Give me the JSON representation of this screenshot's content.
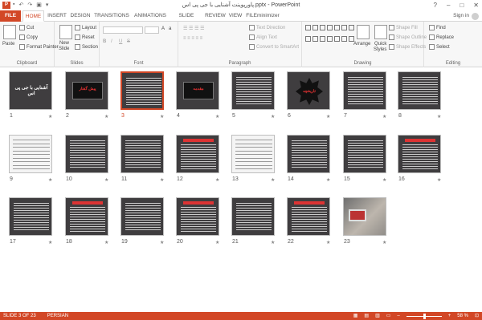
{
  "window": {
    "title": "پاورپوینت آشنایی با جی پی اس.pptx - PowerPoint",
    "app_icon": "P",
    "controls": [
      "?",
      "–",
      "□",
      "✕"
    ]
  },
  "tabs": [
    "FILE",
    "HOME",
    "INSERT",
    "DESIGN",
    "TRANSITIONS",
    "ANIMATIONS",
    "SLIDE SHOW",
    "REVIEW",
    "VIEW",
    "FILEminimizer"
  ],
  "active_tab": "HOME",
  "signin_label": "Sign in",
  "ribbon": {
    "clipboard": {
      "paste": "Paste",
      "cut": "Cut",
      "copy": "Copy",
      "format_painter": "Format Painter",
      "label": "Clipboard"
    },
    "slides": {
      "new_slide_1": "New",
      "new_slide_2": "Slide",
      "layout": "Layout",
      "reset": "Reset",
      "section": "Section",
      "label": "Slides"
    },
    "font": {
      "bold": "B",
      "italic": "I",
      "underline": "U",
      "strike": "S",
      "label": "Font"
    },
    "paragraph": {
      "text_direction": "Text Direction",
      "align_text": "Align Text",
      "convert": "Convert to SmartArt",
      "label": "Paragraph"
    },
    "drawing": {
      "arrange": "Arrange",
      "quick_styles_1": "Quick",
      "quick_styles_2": "Styles",
      "shape_fill": "Shape Fill",
      "shape_outline": "Shape Outline",
      "shape_effects": "Shape Effects",
      "label": "Drawing"
    },
    "editing": {
      "find": "Find",
      "replace": "Replace",
      "select": "Select",
      "label": "Editing"
    }
  },
  "slides": [
    {
      "num": "1",
      "kind": "title-white",
      "text": "آشنایی با جی پی اس"
    },
    {
      "num": "2",
      "kind": "banner",
      "text": "پیش گفتار"
    },
    {
      "num": "3",
      "kind": "lines",
      "selected": true
    },
    {
      "num": "4",
      "kind": "banner",
      "text": "مقدمه"
    },
    {
      "num": "5",
      "kind": "lines"
    },
    {
      "num": "6",
      "kind": "star",
      "text": "تاریخچه"
    },
    {
      "num": "7",
      "kind": "lines"
    },
    {
      "num": "8",
      "kind": "lines"
    },
    {
      "num": "9",
      "kind": "doc"
    },
    {
      "num": "10",
      "kind": "lines"
    },
    {
      "num": "11",
      "kind": "lines"
    },
    {
      "num": "12",
      "kind": "title-red"
    },
    {
      "num": "13",
      "kind": "doc"
    },
    {
      "num": "14",
      "kind": "lines"
    },
    {
      "num": "15",
      "kind": "lines"
    },
    {
      "num": "16",
      "kind": "title-red"
    },
    {
      "num": "17",
      "kind": "lines"
    },
    {
      "num": "18",
      "kind": "title-red"
    },
    {
      "num": "19",
      "kind": "lines"
    },
    {
      "num": "20",
      "kind": "title-red"
    },
    {
      "num": "21",
      "kind": "lines"
    },
    {
      "num": "22",
      "kind": "title-red"
    },
    {
      "num": "23",
      "kind": "photo"
    }
  ],
  "status": {
    "slide_of": "SLIDE 3 OF 23",
    "language": "PERSIAN",
    "zoom": "58 %",
    "zoom_fraction": 0.58
  },
  "colors": {
    "accent": "#d24726"
  }
}
